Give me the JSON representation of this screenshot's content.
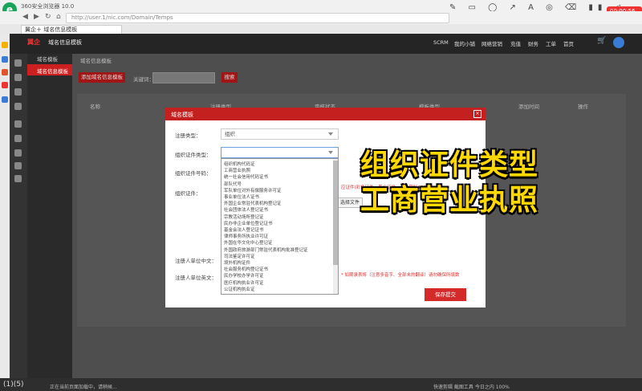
{
  "browser": {
    "logo_letter": "e",
    "title": "360安全浏览器 10.0",
    "address": "http://user.1/nic.com/Domain/Temps",
    "tab_title": "翼企＋ 域名信息模板",
    "record_time": "00:00:56 录制中"
  },
  "app": {
    "brand": "翼企",
    "brand_page": "域名信息模板",
    "top_nav": [
      "SCRM",
      "我的小铺",
      "网络营销",
      "充值",
      "财务",
      "工单",
      "首页"
    ]
  },
  "sidebar": {
    "items": [
      {
        "label": "域名模板"
      },
      {
        "label": "域名信息模板"
      }
    ]
  },
  "page": {
    "breadcrumb": "域名信息模板",
    "add_button": "添加域名信息模板",
    "keyword_label": "关键词：",
    "search_button": "搜索",
    "table_headers": [
      "名称",
      "注册类型",
      "审核状态",
      "模板类型",
      "添加时间",
      "操作"
    ]
  },
  "modal": {
    "title": "域名模板",
    "close": "×",
    "fields": {
      "reg_type_label": "注册类型：",
      "reg_type_value": "组织",
      "cert_type_label": "组织证件类型：",
      "cert_type_value": "",
      "cert_no_label": "组织证件号码：",
      "cert_label": "组织证件：",
      "registrant_cn_label": "注册人单位中文：",
      "registrant_en_label": "注册人单位英文："
    },
    "dropdown_options": [
      "组织机构代码证",
      "工商营业执照",
      "统一社会信用代码证书",
      "部队代号",
      "军队单位对外有偿服务许可证",
      "事业单位法人证书",
      "外国企业常驻代表机构登记证",
      "社会团体法人登记证书",
      "宗教活动场所登记证",
      "民办非企业单位登记证书",
      "基金会法人登记证书",
      "律师事务所执业许可证",
      "外国在华文化中心登记证",
      "外国政府旅游部门常驻代表机构批准登记证",
      "司法鉴定许可证",
      "境外机构证件",
      "社会服务机构登记证书",
      "民办学校办学许可证",
      "医疗机构执业许可证",
      "公证机构执业证"
    ],
    "red_note": "应证件(彩色证件、黑白证件...最大限制2000",
    "upload_button": "选择文件",
    "bottom_note": "* 如期录表将（注意多音字、全部未的翻译）请勿确保所填数",
    "save_button": "保存提交"
  },
  "overlay": {
    "line1": "组织证件类型",
    "line2": "工商营业执照"
  },
  "status": {
    "left": "(1)(5)",
    "mid": "正在当前页面加载中，请稍候...",
    "right": "快速剪辑  截图工具  今日之内  100%"
  }
}
